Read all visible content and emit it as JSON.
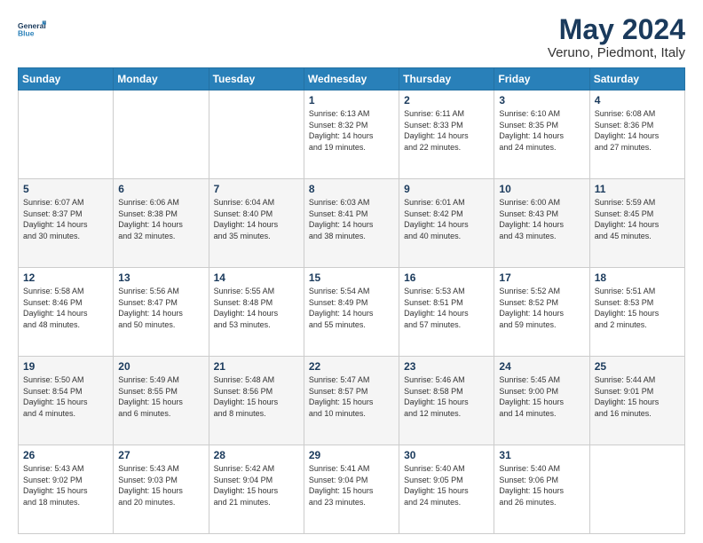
{
  "logo": {
    "line1": "General",
    "line2": "Blue"
  },
  "title": "May 2024",
  "subtitle": "Veruno, Piedmont, Italy",
  "weekdays": [
    "Sunday",
    "Monday",
    "Tuesday",
    "Wednesday",
    "Thursday",
    "Friday",
    "Saturday"
  ],
  "weeks": [
    [
      {
        "day": "",
        "info": ""
      },
      {
        "day": "",
        "info": ""
      },
      {
        "day": "",
        "info": ""
      },
      {
        "day": "1",
        "info": "Sunrise: 6:13 AM\nSunset: 8:32 PM\nDaylight: 14 hours\nand 19 minutes."
      },
      {
        "day": "2",
        "info": "Sunrise: 6:11 AM\nSunset: 8:33 PM\nDaylight: 14 hours\nand 22 minutes."
      },
      {
        "day": "3",
        "info": "Sunrise: 6:10 AM\nSunset: 8:35 PM\nDaylight: 14 hours\nand 24 minutes."
      },
      {
        "day": "4",
        "info": "Sunrise: 6:08 AM\nSunset: 8:36 PM\nDaylight: 14 hours\nand 27 minutes."
      }
    ],
    [
      {
        "day": "5",
        "info": "Sunrise: 6:07 AM\nSunset: 8:37 PM\nDaylight: 14 hours\nand 30 minutes."
      },
      {
        "day": "6",
        "info": "Sunrise: 6:06 AM\nSunset: 8:38 PM\nDaylight: 14 hours\nand 32 minutes."
      },
      {
        "day": "7",
        "info": "Sunrise: 6:04 AM\nSunset: 8:40 PM\nDaylight: 14 hours\nand 35 minutes."
      },
      {
        "day": "8",
        "info": "Sunrise: 6:03 AM\nSunset: 8:41 PM\nDaylight: 14 hours\nand 38 minutes."
      },
      {
        "day": "9",
        "info": "Sunrise: 6:01 AM\nSunset: 8:42 PM\nDaylight: 14 hours\nand 40 minutes."
      },
      {
        "day": "10",
        "info": "Sunrise: 6:00 AM\nSunset: 8:43 PM\nDaylight: 14 hours\nand 43 minutes."
      },
      {
        "day": "11",
        "info": "Sunrise: 5:59 AM\nSunset: 8:45 PM\nDaylight: 14 hours\nand 45 minutes."
      }
    ],
    [
      {
        "day": "12",
        "info": "Sunrise: 5:58 AM\nSunset: 8:46 PM\nDaylight: 14 hours\nand 48 minutes."
      },
      {
        "day": "13",
        "info": "Sunrise: 5:56 AM\nSunset: 8:47 PM\nDaylight: 14 hours\nand 50 minutes."
      },
      {
        "day": "14",
        "info": "Sunrise: 5:55 AM\nSunset: 8:48 PM\nDaylight: 14 hours\nand 53 minutes."
      },
      {
        "day": "15",
        "info": "Sunrise: 5:54 AM\nSunset: 8:49 PM\nDaylight: 14 hours\nand 55 minutes."
      },
      {
        "day": "16",
        "info": "Sunrise: 5:53 AM\nSunset: 8:51 PM\nDaylight: 14 hours\nand 57 minutes."
      },
      {
        "day": "17",
        "info": "Sunrise: 5:52 AM\nSunset: 8:52 PM\nDaylight: 14 hours\nand 59 minutes."
      },
      {
        "day": "18",
        "info": "Sunrise: 5:51 AM\nSunset: 8:53 PM\nDaylight: 15 hours\nand 2 minutes."
      }
    ],
    [
      {
        "day": "19",
        "info": "Sunrise: 5:50 AM\nSunset: 8:54 PM\nDaylight: 15 hours\nand 4 minutes."
      },
      {
        "day": "20",
        "info": "Sunrise: 5:49 AM\nSunset: 8:55 PM\nDaylight: 15 hours\nand 6 minutes."
      },
      {
        "day": "21",
        "info": "Sunrise: 5:48 AM\nSunset: 8:56 PM\nDaylight: 15 hours\nand 8 minutes."
      },
      {
        "day": "22",
        "info": "Sunrise: 5:47 AM\nSunset: 8:57 PM\nDaylight: 15 hours\nand 10 minutes."
      },
      {
        "day": "23",
        "info": "Sunrise: 5:46 AM\nSunset: 8:58 PM\nDaylight: 15 hours\nand 12 minutes."
      },
      {
        "day": "24",
        "info": "Sunrise: 5:45 AM\nSunset: 9:00 PM\nDaylight: 15 hours\nand 14 minutes."
      },
      {
        "day": "25",
        "info": "Sunrise: 5:44 AM\nSunset: 9:01 PM\nDaylight: 15 hours\nand 16 minutes."
      }
    ],
    [
      {
        "day": "26",
        "info": "Sunrise: 5:43 AM\nSunset: 9:02 PM\nDaylight: 15 hours\nand 18 minutes."
      },
      {
        "day": "27",
        "info": "Sunrise: 5:43 AM\nSunset: 9:03 PM\nDaylight: 15 hours\nand 20 minutes."
      },
      {
        "day": "28",
        "info": "Sunrise: 5:42 AM\nSunset: 9:04 PM\nDaylight: 15 hours\nand 21 minutes."
      },
      {
        "day": "29",
        "info": "Sunrise: 5:41 AM\nSunset: 9:04 PM\nDaylight: 15 hours\nand 23 minutes."
      },
      {
        "day": "30",
        "info": "Sunrise: 5:40 AM\nSunset: 9:05 PM\nDaylight: 15 hours\nand 24 minutes."
      },
      {
        "day": "31",
        "info": "Sunrise: 5:40 AM\nSunset: 9:06 PM\nDaylight: 15 hours\nand 26 minutes."
      },
      {
        "day": "",
        "info": ""
      }
    ]
  ]
}
